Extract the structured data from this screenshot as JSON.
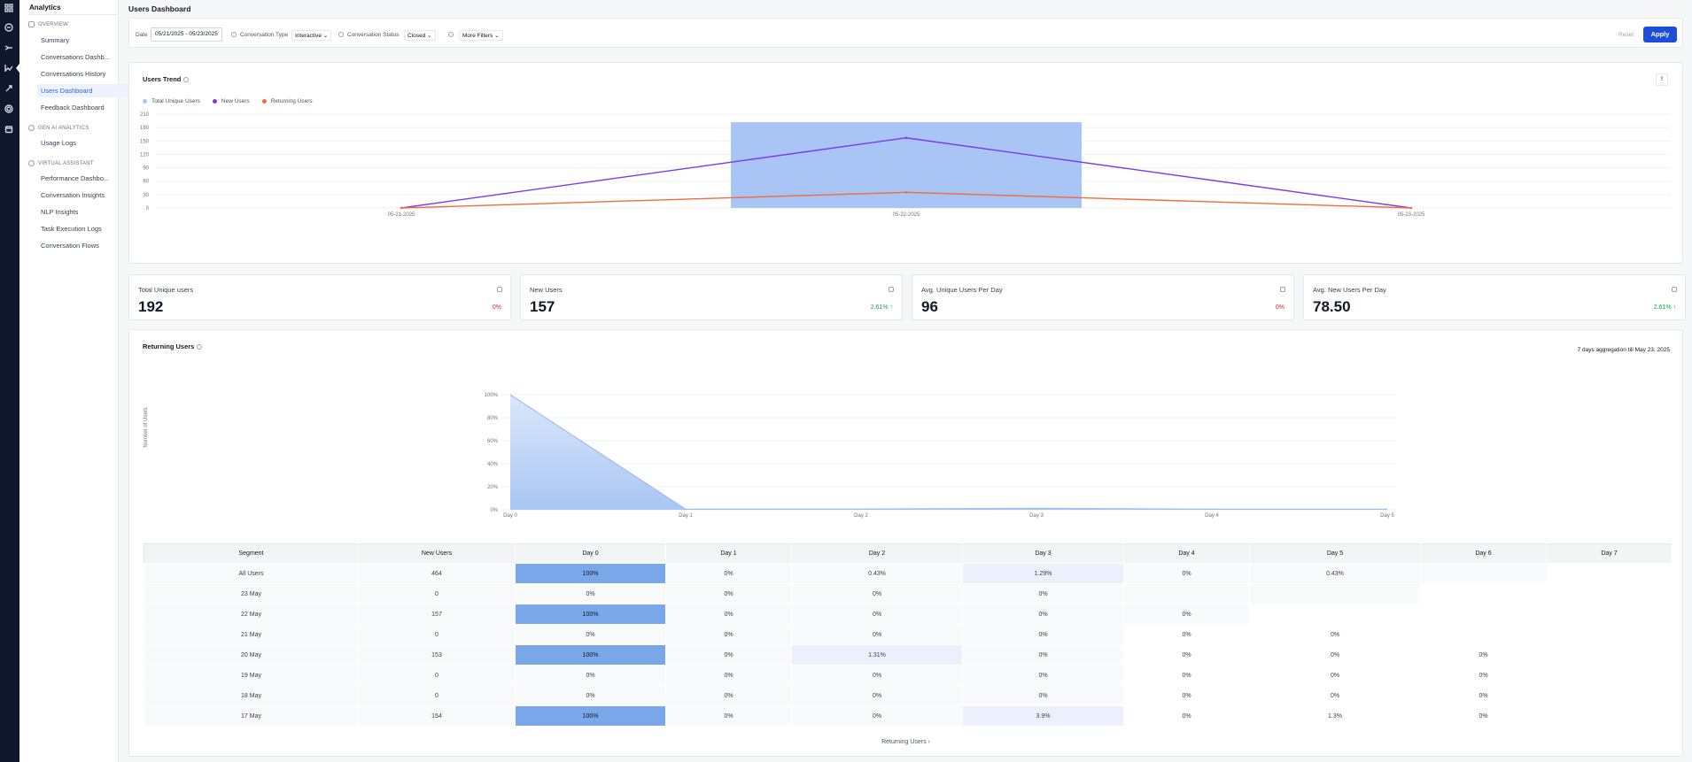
{
  "nav": {
    "app_title": "Analytics",
    "sections": [
      {
        "label": "OVERVIEW",
        "items": [
          "Summary",
          "Conversations Dashb...",
          "Conversations History",
          "Users Dashboard",
          "Feedback Dashboard"
        ]
      },
      {
        "label": "GEN AI ANALYTICS",
        "items": [
          "Usage Logs"
        ]
      },
      {
        "label": "VIRTUAL ASSISTANT",
        "items": [
          "Performance Dashbo...",
          "Conversation Insights",
          "NLP Insights",
          "Task Execution Logs",
          "Conversation Flows"
        ]
      }
    ],
    "active_item": "Users Dashboard"
  },
  "page": {
    "title": "Users Dashboard"
  },
  "filters": {
    "date_label": "Date",
    "date_value": "05/21/2025 - 05/23/2025",
    "conv_type_label": "Conversation Type",
    "conv_type_value": "Interactive",
    "conv_status_label": "Conversation Status",
    "conv_status_value": "Closed",
    "more_filters": "More Filters",
    "reset": "Reset",
    "apply": "Apply"
  },
  "trend": {
    "title": "Users Trend",
    "legend": [
      {
        "name": "Total Unique Users",
        "color": "#a8c5f5"
      },
      {
        "name": "New Users",
        "color": "#7c3aed"
      },
      {
        "name": "Returning Users",
        "color": "#f26b3a"
      }
    ],
    "chart_data": {
      "type": "bar",
      "categories": [
        "05-21-2025",
        "05-22-2025",
        "05-23-2025"
      ],
      "y_ticks": [
        "0",
        "30",
        "60",
        "90",
        "120",
        "150",
        "180",
        "210"
      ],
      "ylim": [
        0,
        210
      ],
      "series": [
        {
          "name": "Total Unique Users",
          "type": "bar",
          "values": [
            0,
            192,
            0
          ]
        },
        {
          "name": "New Users",
          "type": "line",
          "values": [
            0,
            157,
            0
          ]
        },
        {
          "name": "Returning Users",
          "type": "line",
          "values": [
            0,
            35,
            0
          ]
        }
      ]
    }
  },
  "kpis": [
    {
      "title": "Total Unique users",
      "value": "192",
      "change": "0%",
      "trend": "neg"
    },
    {
      "title": "New Users",
      "value": "157",
      "change": "2.61% ↑",
      "trend": "pos"
    },
    {
      "title": "Avg. Unique Users Per Day",
      "value": "96",
      "change": "0%",
      "trend": "neg"
    },
    {
      "title": "Avg. New Users Per Day",
      "value": "78.50",
      "change": "2.61% ↑",
      "trend": "pos"
    }
  ],
  "returning": {
    "title": "Returning Users",
    "aggregation": "7 days aggregation till May 23, 2025",
    "ylabel": "Number of Users",
    "chart_data": {
      "type": "area",
      "categories": [
        "Day 0",
        "Day 1",
        "Day 2",
        "Day 3",
        "Day 4",
        "Day 5"
      ],
      "y_ticks": [
        "0%",
        "20%",
        "40%",
        "60%",
        "80%",
        "100%"
      ],
      "ylim": [
        0,
        100
      ],
      "values": [
        100,
        0.5,
        0.6,
        1.3,
        0.5,
        0.5
      ]
    },
    "table": {
      "headers": [
        "Segment",
        "New Users",
        "Day 0",
        "Day 1",
        "Day 2",
        "Day 3",
        "Day 4",
        "Day 5",
        "Day 6",
        "Day 7"
      ],
      "rows": [
        [
          "All Users",
          "464",
          "100%",
          "0%",
          "0.43%",
          "1.29%",
          "0%",
          "0.43%",
          "",
          ""
        ],
        [
          "23 May",
          "0",
          "0%",
          "0%",
          "0%",
          "0%",
          "",
          "",
          "",
          ""
        ],
        [
          "22 May",
          "157",
          "100%",
          "0%",
          "0%",
          "0%",
          "0%",
          "",
          "",
          ""
        ],
        [
          "21 May",
          "0",
          "0%",
          "0%",
          "0%",
          "0%",
          "0%",
          "0%",
          "",
          ""
        ],
        [
          "20 May",
          "153",
          "100%",
          "0%",
          "1.31%",
          "0%",
          "0%",
          "0%",
          "0%",
          ""
        ],
        [
          "19 May",
          "0",
          "0%",
          "0%",
          "0%",
          "0%",
          "0%",
          "0%",
          "0%",
          ""
        ],
        [
          "18 May",
          "0",
          "0%",
          "0%",
          "0%",
          "0%",
          "0%",
          "0%",
          "0%",
          ""
        ],
        [
          "17 May",
          "154",
          "100%",
          "0%",
          "0%",
          "3.9%",
          "0%",
          "1.3%",
          "0%",
          ""
        ]
      ],
      "gray_cols": [
        9,
        8,
        7,
        6,
        6,
        6,
        6,
        6
      ]
    },
    "link": "Returning Users ›"
  }
}
